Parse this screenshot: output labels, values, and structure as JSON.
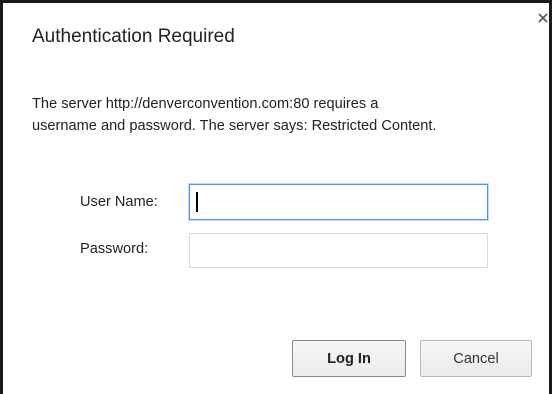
{
  "dialog": {
    "title": "Authentication Required",
    "message_line1": "The server http://denverconvention.com:80 requires a",
    "message_line2": "username and password. The server says: Restricted Content.",
    "close_icon": "close-icon"
  },
  "form": {
    "username_label": "User Name:",
    "username_value": "",
    "password_label": "Password:",
    "password_value": ""
  },
  "buttons": {
    "login_label": "Log In",
    "cancel_label": "Cancel"
  },
  "colors": {
    "focus_border": "#4d90fe",
    "text": "#222222",
    "input_border": "#d9d9d9",
    "window_border": "#1a1a1a"
  }
}
